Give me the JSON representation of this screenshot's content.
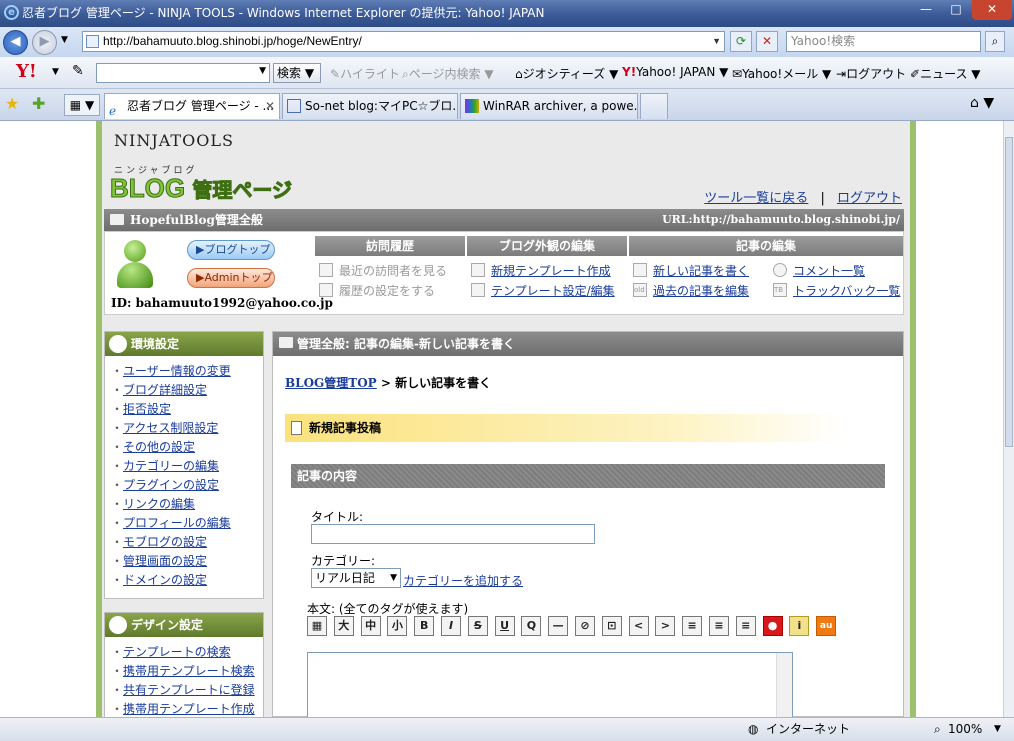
{
  "window": {
    "title": "忍者ブログ 管理ページ - NINJA TOOLS - Windows Internet Explorer の提供元: Yahoo! JAPAN"
  },
  "address": {
    "url": "http://bahamuuto.blog.shinobi.jp/hoge/NewEntry/",
    "search_placeholder": "Yahoo!検索"
  },
  "yahoo_toolbar": {
    "logo": "Y!",
    "search_button": "検索",
    "highlight": "ハイライト",
    "page_search": "ページ内検索",
    "items": [
      "ジオシティーズ",
      "Yahoo! JAPAN",
      "Yahoo!メール",
      "ログアウト",
      "ニュース"
    ]
  },
  "tabs": [
    {
      "label": "忍者ブログ 管理ページ - ..."
    },
    {
      "label": "So-net blog:マイPC☆ブロ..."
    },
    {
      "label": "WinRAR archiver, a powe..."
    }
  ],
  "status": {
    "zone": "インターネット",
    "zoom": "100%"
  },
  "page": {
    "ninja_logo": "NINJATOOLS",
    "blog_sub": "ニンジャブログ",
    "blog_logo_a": "BLOG",
    "blog_logo_b": "管理ページ",
    "tool_list_link": "ツール一覧に戻る",
    "separator": "|",
    "logout_link": "ログアウト",
    "header_title": "HopefulBlog管理全般",
    "header_url": "URL:http://bahamuuto.blog.shinobi.jp/",
    "blog_top_btn": "▶ブログトップ",
    "admin_top_btn": "▶Adminトップ",
    "user_id": "ID:  bahamuuto1992@yahoo.co.jp",
    "columns": {
      "visit": {
        "title": "訪問履歴",
        "items": [
          "最近の訪問者を見る",
          "履歴の設定をする"
        ]
      },
      "look": {
        "title": "ブログ外観の編集",
        "items": [
          "新規テンプレート作成",
          "テンプレート設定/編集"
        ]
      },
      "article": {
        "title": "記事の編集",
        "items": [
          "新しい記事を書く",
          "過去の記事を編集",
          "コメント一覧",
          "トラックバック一覧"
        ]
      }
    },
    "env": {
      "title": "環境設定",
      "items": [
        "ユーザー情報の変更",
        "ブログ詳細設定",
        "拒否設定",
        "アクセス制限設定",
        "その他の設定",
        "カテゴリーの編集",
        "プラグインの設定",
        "リンクの編集",
        "プロフィールの編集",
        "モブログの設定",
        "管理画面の設定",
        "ドメインの設定"
      ]
    },
    "design": {
      "title": "デザイン設定",
      "items": [
        "テンプレートの検索",
        "携帯用テンプレート検索",
        "共有テンプレートに登録",
        "携帯用テンプレート作成"
      ]
    },
    "main": {
      "header": "管理全般: 記事の編集-新しい記事を書く",
      "crumb_link": "BLOG管理TOP",
      "crumb_rest": " > 新しい記事を書く",
      "post_title": "新規記事投稿",
      "section": "記事の内容",
      "title_label": "タイトル:",
      "category_label": "カテゴリー:",
      "category_value": "リアル日記",
      "add_category": "カテゴリーを追加する",
      "body_label": "本文: (全てのタグが使えます)",
      "toolbar": [
        "▦",
        "大",
        "中",
        "小",
        "B",
        "I",
        "S",
        "U",
        "Q",
        "—",
        "⊘",
        "⊡",
        "<",
        ">",
        "≡",
        "≡",
        "≡",
        "●",
        "i",
        "au"
      ]
    }
  }
}
